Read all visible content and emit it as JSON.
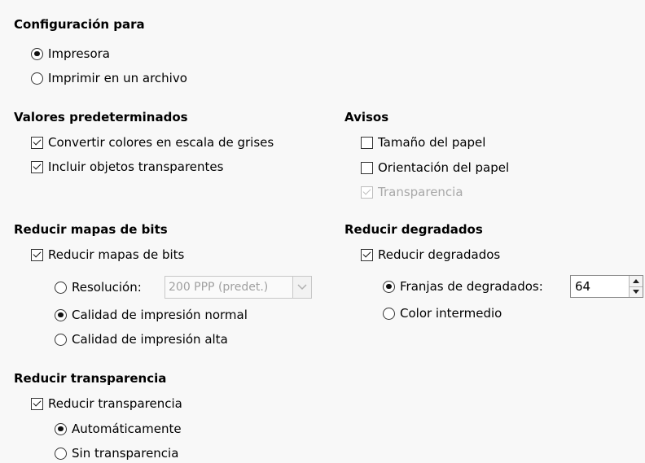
{
  "config": {
    "header": "Configuración para",
    "printer": "Impresora",
    "file": "Imprimir en un archivo"
  },
  "defaults": {
    "header": "Valores predeterminados",
    "grayscale": "Convertir colores en escala de grises",
    "transparent_objects": "Incluir objetos transparentes"
  },
  "warnings": {
    "header": "Avisos",
    "paper_size": "Tamaño del papel",
    "paper_orientation": "Orientación del papel",
    "transparency": "Transparencia"
  },
  "bitmaps": {
    "header": "Reducir mapas de bits",
    "reduce": "Reducir mapas de bits",
    "resolution": "Resolución:",
    "resolution_value": "200 PPP (predet.)",
    "normal_quality": "Calidad de impresión normal",
    "high_quality": "Calidad de impresión alta"
  },
  "gradients": {
    "header": "Reducir degradados",
    "reduce": "Reducir degradados",
    "stripes": "Franjas de degradados:",
    "stripes_value": "64",
    "intermediate": "Color intermedio"
  },
  "transparency": {
    "header": "Reducir transparencia",
    "reduce": "Reducir transparencia",
    "auto": "Automáticamente",
    "none": "Sin transparencia"
  }
}
